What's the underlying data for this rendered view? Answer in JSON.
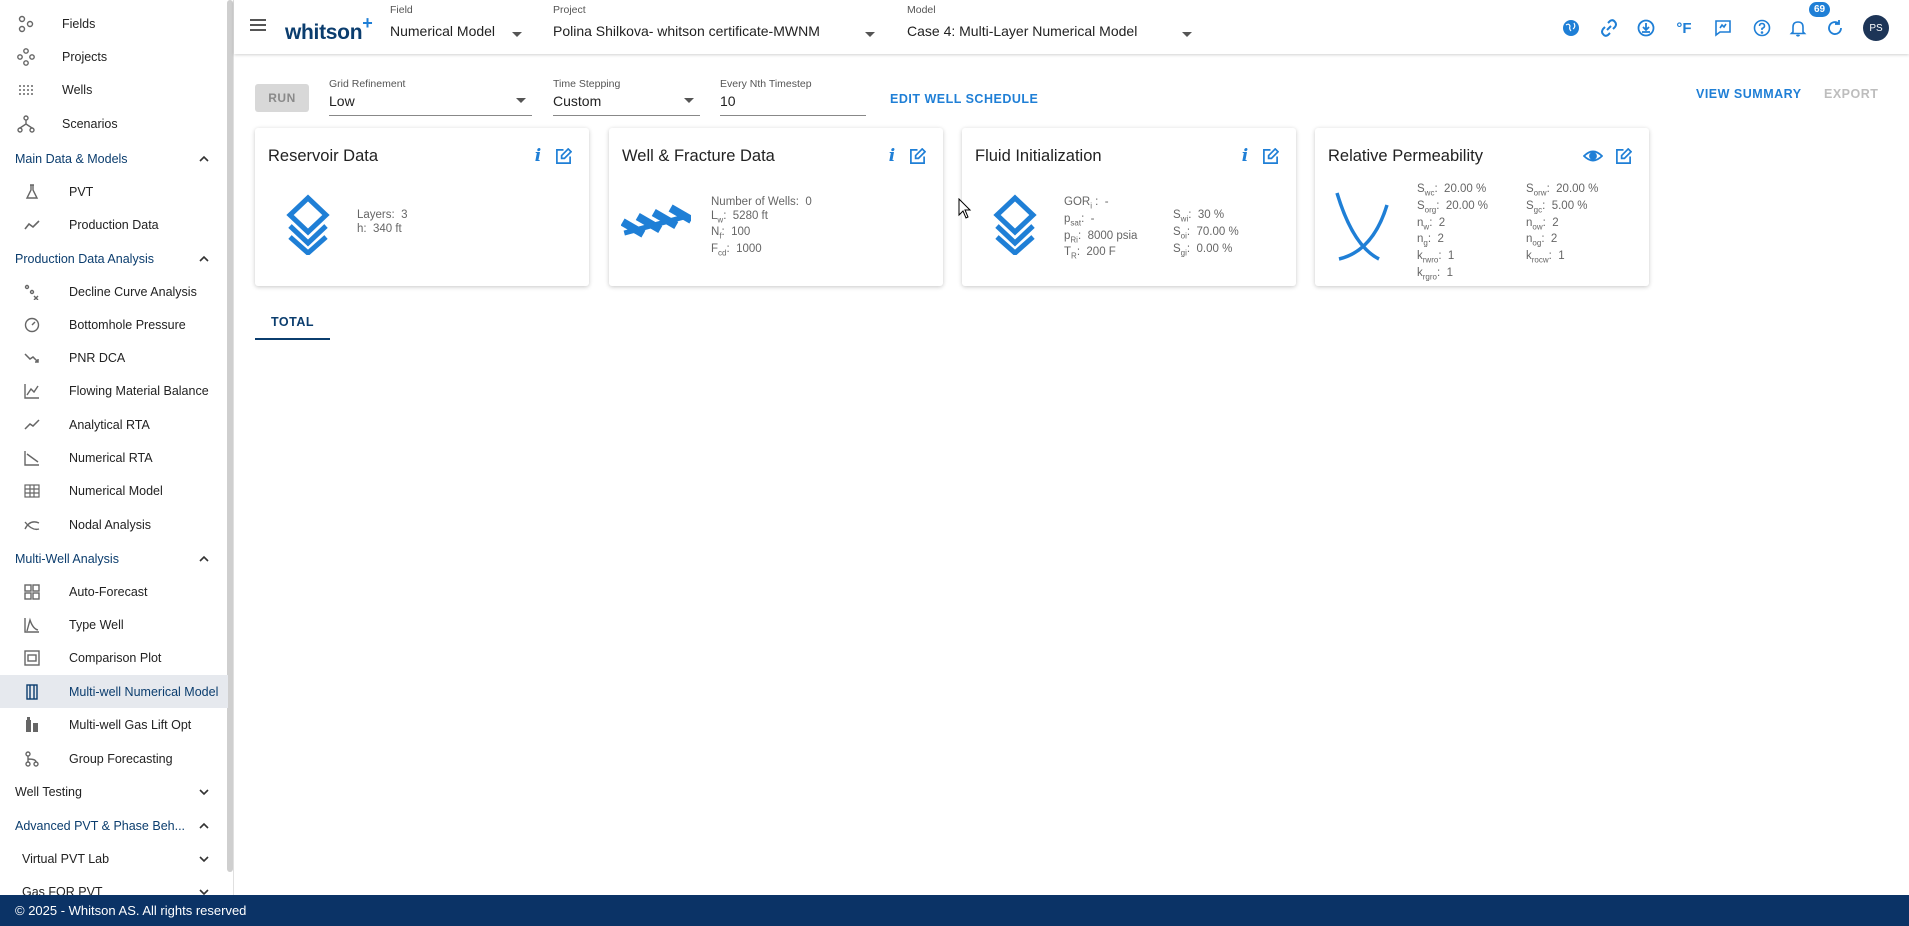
{
  "sidebar": {
    "items": [
      {
        "label": "Fields",
        "icon": "fields-icon"
      },
      {
        "label": "Projects",
        "icon": "projects-icon"
      },
      {
        "label": "Wells",
        "icon": "wells-icon"
      },
      {
        "label": "Scenarios",
        "icon": "scenarios-icon"
      }
    ],
    "sections": [
      {
        "label": "Main Data & Models",
        "items": [
          {
            "label": "PVT",
            "icon": "flask-icon"
          },
          {
            "label": "Production Data",
            "icon": "trend-icon"
          }
        ]
      },
      {
        "label": "Production Data Analysis",
        "items": [
          {
            "label": "Decline Curve Analysis",
            "icon": "scatter-icon"
          },
          {
            "label": "Bottomhole Pressure",
            "icon": "gauge-icon"
          },
          {
            "label": "PNR DCA",
            "icon": "decline-icon"
          },
          {
            "label": "Flowing Material Balance",
            "icon": "chart-icon"
          },
          {
            "label": "Analytical RTA",
            "icon": "line-icon"
          },
          {
            "label": "Numerical RTA",
            "icon": "rta-icon"
          },
          {
            "label": "Numerical Model",
            "icon": "grid-icon"
          },
          {
            "label": "Nodal Analysis",
            "icon": "nodal-icon"
          }
        ]
      },
      {
        "label": "Multi-Well Analysis",
        "items": [
          {
            "label": "Auto-Forecast",
            "icon": "dashboard-icon"
          },
          {
            "label": "Type Well",
            "icon": "typewell-icon"
          },
          {
            "label": "Comparison Plot",
            "icon": "comparison-icon"
          },
          {
            "label": "Multi-well Numerical Model",
            "icon": "columns-icon"
          },
          {
            "label": "Multi-well Gas Lift Opt",
            "icon": "gaslift-icon"
          },
          {
            "label": "Group Forecasting",
            "icon": "branch-icon"
          }
        ]
      },
      {
        "label": "Well Testing"
      },
      {
        "label": "Advanced PVT & Phase Beh..."
      }
    ],
    "subsections": [
      {
        "label": "Virtual PVT Lab"
      },
      {
        "label": "Gas FOR PVT"
      }
    ]
  },
  "header": {
    "logo": "whitson",
    "logo_plus": "+",
    "field": {
      "caption": "Field",
      "value": "Numerical Model"
    },
    "project": {
      "caption": "Project",
      "value": "Polina Shilkova- whitson certificate-MWNM"
    },
    "model": {
      "caption": "Model",
      "value": "Case 4: Multi-Layer Numerical Model"
    },
    "notifications_count": "69",
    "units_label": "°F",
    "avatar_initials": "PS"
  },
  "toolbar": {
    "run_label": "RUN",
    "grid_refinement": {
      "caption": "Grid Refinement",
      "value": "Low"
    },
    "time_stepping": {
      "caption": "Time Stepping",
      "value": "Custom"
    },
    "nth_timestep": {
      "caption": "Every Nth Timestep",
      "value": "10"
    },
    "edit_schedule_label": "EDIT WELL SCHEDULE",
    "view_summary_label": "VIEW SUMMARY",
    "export_label": "EXPORT"
  },
  "cards": {
    "reservoir": {
      "title": "Reservoir Data",
      "layers_label": "Layers:",
      "layers_value": "3",
      "h_label": "h:",
      "h_value": "340 ft"
    },
    "well": {
      "title": "Well & Fracture Data",
      "nwells_label": "Number of Wells:",
      "nwells_value": "0",
      "lw_value": "5280 ft",
      "nf_value": "100",
      "fcd_value": "1000"
    },
    "fluid": {
      "title": "Fluid Initialization",
      "gor_value": "-",
      "psat_value": "-",
      "pri_value": "8000 psia",
      "tr_value": "200 F",
      "swi_value": "30 %",
      "soi_value": "70.00 %",
      "sgi_value": "0.00 %"
    },
    "relperm": {
      "title": "Relative Permeability",
      "swc": "20.00 %",
      "sorg": "20.00 %",
      "nw": "2",
      "ng": "2",
      "krwro": "1",
      "krgro": "1",
      "sorw": "20.00 %",
      "sgc": "5.00 %",
      "now": "2",
      "nog": "2",
      "krocw": "1"
    }
  },
  "tabs": [
    {
      "label": "TOTAL"
    }
  ],
  "footer": {
    "text": "© 2025 - Whitson AS. All rights reserved"
  }
}
